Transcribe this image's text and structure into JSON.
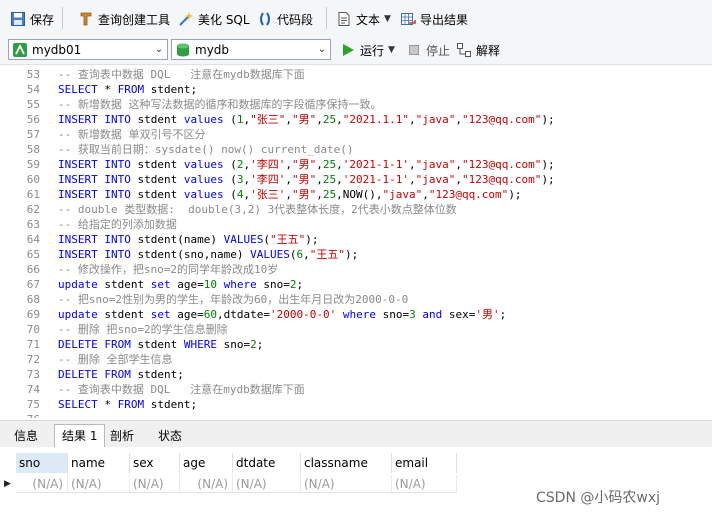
{
  "toolbar": {
    "save": "保存",
    "query_builder": "查询创建工具",
    "beautify_sql": "美化 SQL",
    "code_snippet": "代码段",
    "text": "文本",
    "export_results": "导出结果"
  },
  "toolbar2": {
    "connection": "mydb01",
    "database": "mydb",
    "run": "运行",
    "stop": "停止",
    "explain": "解释"
  },
  "editor": {
    "lines": [
      {
        "n": "53",
        "segs": [
          [
            "cm",
            "-- 查询表中数据 DQL   注意在mydb数据库下面"
          ]
        ]
      },
      {
        "n": "54",
        "segs": [
          [
            "kw",
            "SELECT"
          ],
          [
            "tx",
            " * "
          ],
          [
            "kw",
            "FROM"
          ],
          [
            "tx",
            " stdent;"
          ]
        ]
      },
      {
        "n": "55",
        "segs": [
          [
            "cm",
            "-- 新增数据 这种写法数据的循序和数据库的字段循序保持一致。"
          ]
        ]
      },
      {
        "n": "56",
        "segs": [
          [
            "kw",
            "INSERT INTO"
          ],
          [
            "tx",
            " stdent "
          ],
          [
            "kw",
            "values"
          ],
          [
            "tx",
            " ("
          ],
          [
            "nm",
            "1"
          ],
          [
            "tx",
            ","
          ],
          [
            "st",
            "\"张三\""
          ],
          [
            "tx",
            ","
          ],
          [
            "st",
            "\"男\""
          ],
          [
            "tx",
            ","
          ],
          [
            "nm",
            "25"
          ],
          [
            "tx",
            ","
          ],
          [
            "st",
            "\"2021.1.1\""
          ],
          [
            "tx",
            ","
          ],
          [
            "st",
            "\"java\""
          ],
          [
            "tx",
            ","
          ],
          [
            "st",
            "\"123@qq.com\""
          ],
          [
            "tx",
            ");"
          ]
        ]
      },
      {
        "n": "57",
        "segs": [
          [
            "cm",
            "-- 新增数据 单双引号不区分"
          ]
        ]
      },
      {
        "n": "58",
        "segs": [
          [
            "cm",
            "-- 获取当前日期：sysdate() now() current_date()"
          ]
        ]
      },
      {
        "n": "59",
        "segs": [
          [
            "kw",
            "INSERT INTO"
          ],
          [
            "tx",
            " stdent "
          ],
          [
            "kw",
            "values"
          ],
          [
            "tx",
            " ("
          ],
          [
            "nm",
            "2"
          ],
          [
            "tx",
            ","
          ],
          [
            "st",
            "'李四'"
          ],
          [
            "tx",
            ","
          ],
          [
            "st",
            "\"男\""
          ],
          [
            "tx",
            ","
          ],
          [
            "nm",
            "25"
          ],
          [
            "tx",
            ","
          ],
          [
            "st",
            "'2021-1-1'"
          ],
          [
            "tx",
            ","
          ],
          [
            "st",
            "\"java\""
          ],
          [
            "tx",
            ","
          ],
          [
            "st",
            "\"123@qq.com\""
          ],
          [
            "tx",
            ");"
          ]
        ]
      },
      {
        "n": "60",
        "segs": [
          [
            "kw",
            "INSERT INTO"
          ],
          [
            "tx",
            " stdent "
          ],
          [
            "kw",
            "values"
          ],
          [
            "tx",
            " ("
          ],
          [
            "nm",
            "3"
          ],
          [
            "tx",
            ","
          ],
          [
            "st",
            "'李四'"
          ],
          [
            "tx",
            ","
          ],
          [
            "st",
            "\"男\""
          ],
          [
            "tx",
            ","
          ],
          [
            "nm",
            "25"
          ],
          [
            "tx",
            ","
          ],
          [
            "st",
            "'2021-1-1'"
          ],
          [
            "tx",
            ","
          ],
          [
            "st",
            "\"java\""
          ],
          [
            "tx",
            ","
          ],
          [
            "st",
            "\"123@qq.com\""
          ],
          [
            "tx",
            ");"
          ]
        ]
      },
      {
        "n": "61",
        "segs": [
          [
            "kw",
            "INSERT INTO"
          ],
          [
            "tx",
            " stdent "
          ],
          [
            "kw",
            "values"
          ],
          [
            "tx",
            " ("
          ],
          [
            "nm",
            "4"
          ],
          [
            "tx",
            ","
          ],
          [
            "st",
            "'张三'"
          ],
          [
            "tx",
            ","
          ],
          [
            "st",
            "\"男\""
          ],
          [
            "tx",
            ","
          ],
          [
            "nm",
            "25"
          ],
          [
            "tx",
            ",NOW(),"
          ],
          [
            "st",
            "\"java\""
          ],
          [
            "tx",
            ","
          ],
          [
            "st",
            "\"123@qq.com\""
          ],
          [
            "tx",
            ");"
          ]
        ]
      },
      {
        "n": "62",
        "segs": [
          [
            "cm",
            "-- double 类型数据:  double(3,2) 3代表整体长度，2代表小数点整体位数"
          ]
        ]
      },
      {
        "n": "63",
        "segs": [
          [
            "cm",
            "-- 给指定的列添加数据"
          ]
        ]
      },
      {
        "n": "64",
        "segs": [
          [
            "kw",
            "INSERT INTO"
          ],
          [
            "tx",
            " stdent(name) "
          ],
          [
            "kw",
            "VALUES"
          ],
          [
            "tx",
            "("
          ],
          [
            "st",
            "\"王五\""
          ],
          [
            "tx",
            ");"
          ]
        ]
      },
      {
        "n": "65",
        "segs": [
          [
            "kw",
            "INSERT INTO"
          ],
          [
            "tx",
            " stdent(sno,name) "
          ],
          [
            "kw",
            "VALUES"
          ],
          [
            "tx",
            "("
          ],
          [
            "nm",
            "6"
          ],
          [
            "tx",
            ","
          ],
          [
            "st",
            "\"王五\""
          ],
          [
            "tx",
            ");"
          ]
        ]
      },
      {
        "n": "66",
        "segs": [
          [
            "cm",
            "-- 修改操作，把sno=2的同学年龄改成10岁"
          ]
        ]
      },
      {
        "n": "67",
        "segs": [
          [
            "kw",
            "update"
          ],
          [
            "tx",
            " stdent "
          ],
          [
            "kw",
            "set"
          ],
          [
            "tx",
            " age="
          ],
          [
            "nm",
            "10"
          ],
          [
            "tx",
            " "
          ],
          [
            "kw",
            "where"
          ],
          [
            "tx",
            " sno="
          ],
          [
            "nm",
            "2"
          ],
          [
            "tx",
            ";"
          ]
        ]
      },
      {
        "n": "68",
        "segs": [
          [
            "cm",
            "-- 把sno=2性别为男的学生，年龄改为60，出生年月日改为2000-0-0"
          ]
        ]
      },
      {
        "n": "69",
        "segs": [
          [
            "kw",
            "update"
          ],
          [
            "tx",
            " stdent "
          ],
          [
            "kw",
            "set"
          ],
          [
            "tx",
            " age="
          ],
          [
            "nm",
            "60"
          ],
          [
            "tx",
            ",dtdate="
          ],
          [
            "st",
            "'2000-0-0'"
          ],
          [
            "tx",
            " "
          ],
          [
            "kw",
            "where"
          ],
          [
            "tx",
            " sno="
          ],
          [
            "nm",
            "3"
          ],
          [
            "tx",
            " "
          ],
          [
            "kw",
            "and"
          ],
          [
            "tx",
            " sex="
          ],
          [
            "st",
            "'男'"
          ],
          [
            "tx",
            ";"
          ]
        ]
      },
      {
        "n": "70",
        "segs": [
          [
            "cm",
            "-- 删除 把sno=2的学生信息删除"
          ]
        ]
      },
      {
        "n": "71",
        "segs": [
          [
            "kw",
            "DELETE FROM"
          ],
          [
            "tx",
            " stdent "
          ],
          [
            "kw",
            "WHERE"
          ],
          [
            "tx",
            " sno="
          ],
          [
            "nm",
            "2"
          ],
          [
            "tx",
            ";"
          ]
        ]
      },
      {
        "n": "72",
        "segs": [
          [
            "cm",
            "-- 删除 全部学生信息"
          ]
        ]
      },
      {
        "n": "73",
        "segs": [
          [
            "kw",
            "DELETE FROM"
          ],
          [
            "tx",
            " stdent;"
          ]
        ]
      },
      {
        "n": "74",
        "segs": [
          [
            "cm",
            "-- 查询表中数据 DQL   注意在mydb数据库下面"
          ]
        ]
      },
      {
        "n": "75",
        "segs": [
          [
            "kw",
            "SELECT"
          ],
          [
            "tx",
            " * "
          ],
          [
            "kw",
            "FROM"
          ],
          [
            "tx",
            " stdent;"
          ]
        ]
      },
      {
        "n": "76",
        "segs": []
      }
    ]
  },
  "tabs": [
    "信息",
    "结果 1",
    "剖析",
    "状态"
  ],
  "grid": {
    "columns": [
      "sno",
      "name",
      "sex",
      "age",
      "dtdate",
      "classname",
      "email"
    ],
    "row": [
      "(N/A)",
      "(N/A)",
      "(N/A)",
      "(N/A)",
      "(N/A)",
      "(N/A)",
      "(N/A)"
    ],
    "row_marker": "▶"
  },
  "watermark": "CSDN @小码农wxj",
  "colors": {
    "keyword": "#0000ff",
    "string": "#cc0000",
    "number": "#008000",
    "comment": "#8a8a8a",
    "run_icon": "#2aa52a"
  },
  "icons": [
    "save-icon",
    "query-builder-icon",
    "beautify-icon",
    "code-snippet-icon",
    "text-icon",
    "export-icon",
    "connection-icon",
    "database-icon",
    "run-icon",
    "stop-icon",
    "explain-icon"
  ]
}
